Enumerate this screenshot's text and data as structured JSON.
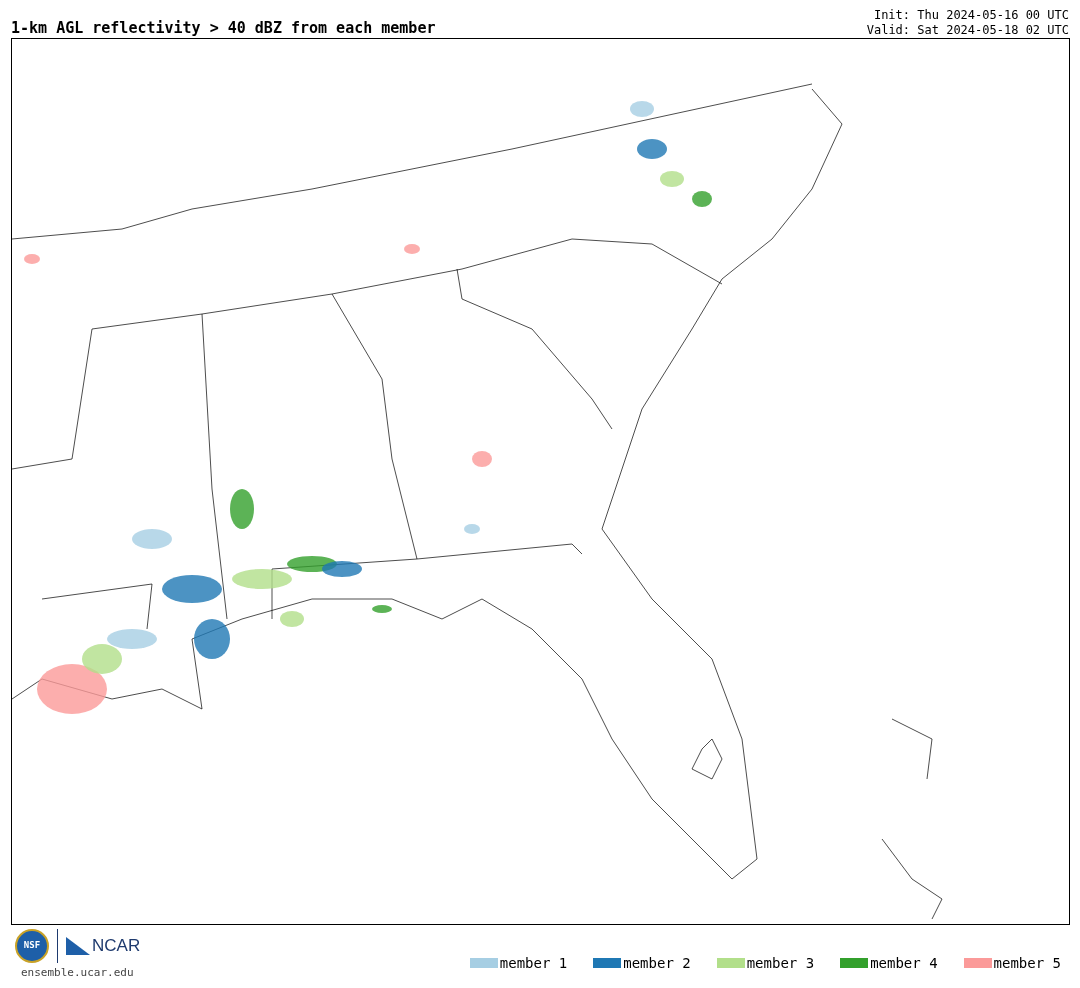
{
  "title": "1-km AGL reflectivity > 40 dBZ from each member",
  "init": "Init: Thu 2024-05-16 00 UTC",
  "valid": "Valid: Sat 2024-05-18 02 UTC",
  "logos": {
    "nsf": "NSF",
    "ncar": "NCAR",
    "url": "ensemble.ucar.edu"
  },
  "legend": [
    {
      "label": "member 1",
      "color": "#a6cee3"
    },
    {
      "label": "member 2",
      "color": "#1f78b4"
    },
    {
      "label": "member 3",
      "color": "#b2df8a"
    },
    {
      "label": "member 4",
      "color": "#33a02c"
    },
    {
      "label": "member 5",
      "color": "#fb9a99"
    }
  ]
}
